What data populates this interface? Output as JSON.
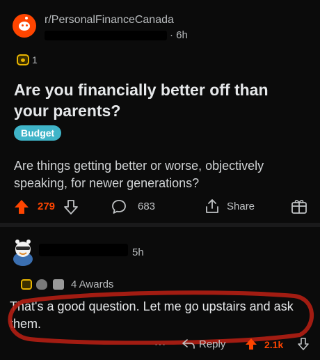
{
  "post": {
    "subreddit": "r/PersonalFinanceCanada",
    "time": "· 6h",
    "award_count": "1",
    "title": "Are you financially better off than your parents?",
    "flair": "Budget",
    "body": "Are things getting better or worse, objectively speaking, for newer generations?",
    "votes": "279",
    "comments": "683",
    "share_label": "Share"
  },
  "comment": {
    "time": "5h",
    "awards_label": "4 Awards",
    "text": "That's a good question. Let me go upstairs and ask them.",
    "reply_label": "Reply",
    "votes": "2.1k",
    "more": "···"
  },
  "colors": {
    "background": "#0b0b0b",
    "upvote": "#ff4500",
    "flair": "#3fb4c8",
    "annotation": "#b01e14"
  },
  "icons": [
    "reddit-alien-icon",
    "award-icon",
    "upvote-icon",
    "downvote-icon",
    "comment-icon",
    "share-icon",
    "gift-icon",
    "reply-icon"
  ]
}
